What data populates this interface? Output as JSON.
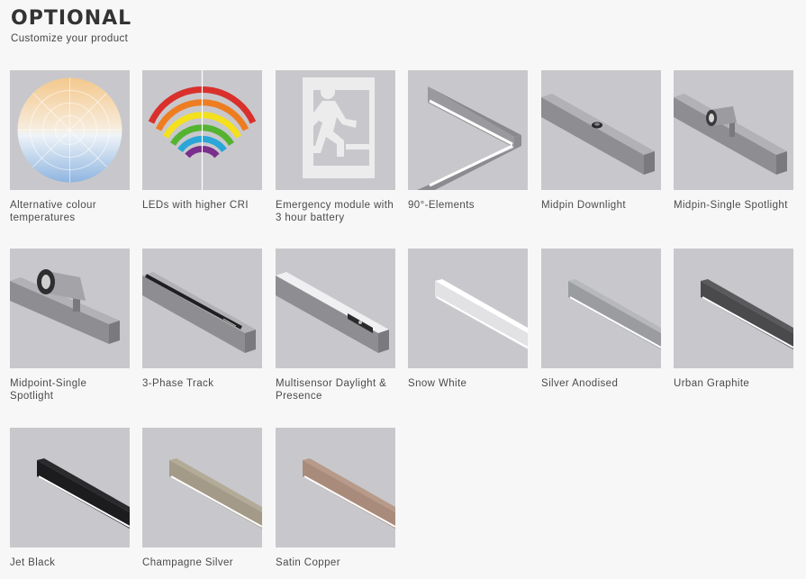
{
  "header": {
    "title": "OPTIONAL",
    "subtitle": "Customize your product"
  },
  "options": [
    {
      "label": "Alternative colour temperatures",
      "icon": "colour-temperature-wheel"
    },
    {
      "label": "LEDs with higher CRI",
      "icon": "rainbow-cri"
    },
    {
      "label": "Emergency module with 3 hour battery",
      "icon": "emergency-exit"
    },
    {
      "label": "90°-Elements",
      "icon": "corner-profile"
    },
    {
      "label": "Midpin Downlight",
      "icon": "midpin-downlight"
    },
    {
      "label": "Midpin-Single Spotlight",
      "icon": "midpin-spotlight"
    },
    {
      "label": "Midpoint-Single Spotlight",
      "icon": "midpoint-spotlight"
    },
    {
      "label": "3-Phase Track",
      "icon": "three-phase-track"
    },
    {
      "label": "Multisensor Daylight & Presence",
      "icon": "multisensor"
    },
    {
      "label": "Snow White",
      "icon": "profile-snow-white",
      "color": "#f2f2f4"
    },
    {
      "label": "Silver Anodised",
      "icon": "profile-silver",
      "color": "#9a9c9f"
    },
    {
      "label": "Urban Graphite",
      "icon": "profile-graphite",
      "color": "#4a4a4c"
    },
    {
      "label": "Jet Black",
      "icon": "profile-black",
      "color": "#1c1c1e"
    },
    {
      "label": "Champagne Silver",
      "icon": "profile-champagne",
      "color": "#a39a88"
    },
    {
      "label": "Satin Copper",
      "icon": "profile-copper",
      "color": "#a98b7b"
    }
  ]
}
